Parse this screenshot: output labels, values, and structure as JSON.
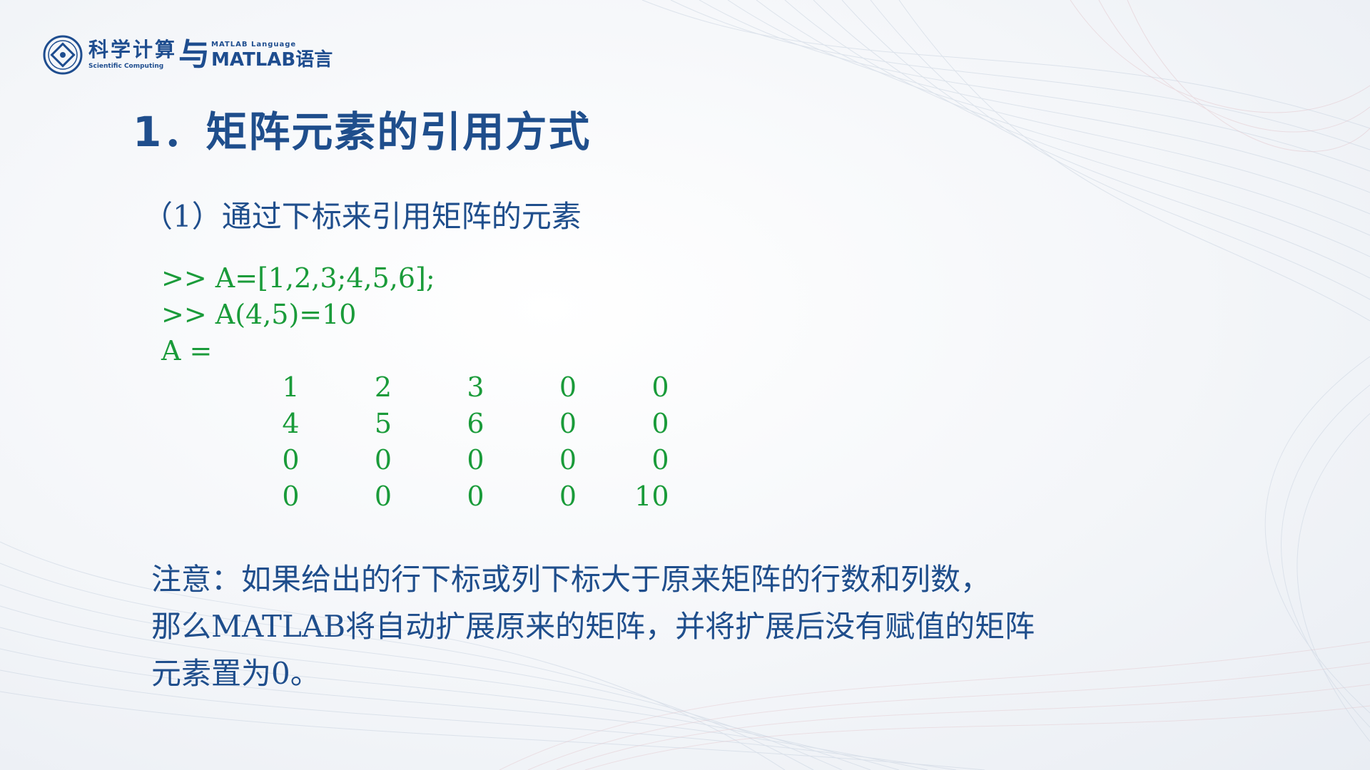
{
  "logo": {
    "cn_text": "科学计算",
    "yu_text": "与",
    "en_small": "Scientific Computing",
    "matlab_lang": "MATLAB Language",
    "matlab_text": "MATLAB语言"
  },
  "title": "1．矩阵元素的引用方式",
  "subtitle": "（1）通过下标来引用矩阵的元素",
  "code": {
    "lines": [
      ">> A=[1,2,3;4,5,6];",
      ">> A(4,5)=10",
      "A ="
    ],
    "matrix": [
      [
        "1",
        "2",
        "3",
        "0",
        "0"
      ],
      [
        "4",
        "5",
        "6",
        "0",
        "0"
      ],
      [
        "0",
        "0",
        "0",
        "0",
        "0"
      ],
      [
        "0",
        "0",
        "0",
        "0",
        "10"
      ]
    ]
  },
  "note": {
    "lines": [
      "注意：如果给出的行下标或列下标大于原来矩阵的行数和列数，",
      "那么MATLAB将自动扩展原来的矩阵，并将扩展后没有赋值的矩阵",
      "元素置为0。"
    ]
  },
  "colors": {
    "title_blue": "#1f4e8c",
    "code_green": "#1a9b3a"
  }
}
